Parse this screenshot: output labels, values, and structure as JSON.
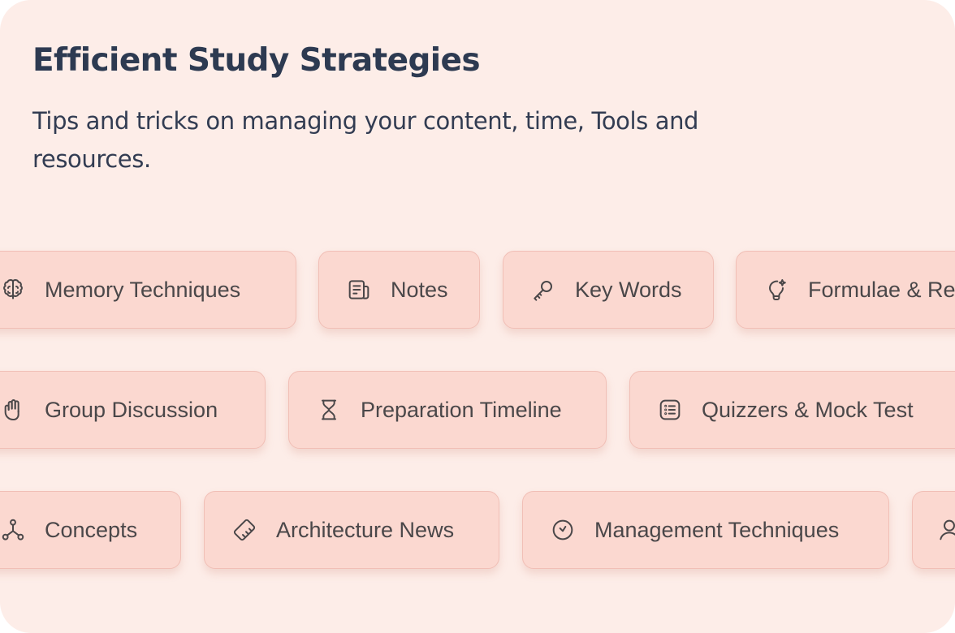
{
  "header": {
    "title": "Efficient Study Strategies",
    "subtitle": "Tips and tricks on managing your content, time, Tools and resources."
  },
  "colors": {
    "card_background": "#fdede8",
    "chip_background": "#fbd8d0",
    "chip_border": "#f1bfb6",
    "title_text": "#2d3a51",
    "chip_text": "#4a4749"
  },
  "chips": {
    "row1": [
      {
        "label": "Memory Techniques",
        "icon": "brain-icon"
      },
      {
        "label": "Notes",
        "icon": "notes-icon"
      },
      {
        "label": "Key Words",
        "icon": "key-icon"
      },
      {
        "label": "Formulae & Re",
        "icon": "lightbulb-icon"
      }
    ],
    "row2": [
      {
        "label": "Group Discussion",
        "icon": "hand-icon"
      },
      {
        "label": "Preparation Timeline",
        "icon": "hourglass-icon"
      },
      {
        "label": "Quizzers & Mock Test",
        "icon": "list-icon"
      }
    ],
    "row3": [
      {
        "label": "Concepts",
        "icon": "network-icon"
      },
      {
        "label": "Architecture News",
        "icon": "ruler-icon"
      },
      {
        "label": "Management Techniques",
        "icon": "clock-icon"
      },
      {
        "label": "",
        "icon": "user-icon"
      }
    ]
  }
}
